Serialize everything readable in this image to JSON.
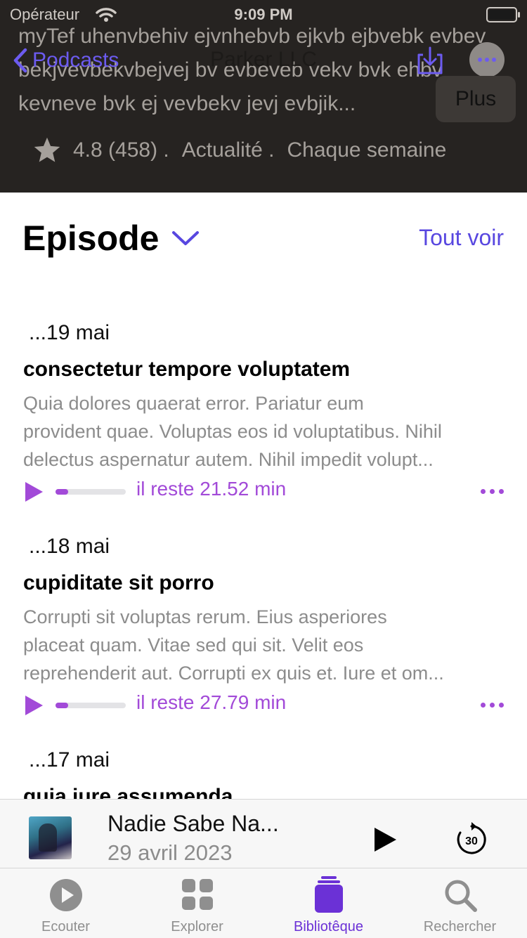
{
  "status_bar": {
    "carrier": "Opérateur",
    "time": "9:09 PM"
  },
  "podcast": {
    "description": "myTef uhenvbehiv ejvnhebvb ejkvb ejbvebk evbev bekjvevbekvbejvej bv evbeveb vekv bvk ehbv kevneve bvk ej vevbekv jevj evbjik...",
    "rating_text": "4.8 (458) .",
    "category": "Actualité .",
    "frequency": "Chaque semaine"
  },
  "nav": {
    "back_label": "Podcasts",
    "title": "Parker LLC",
    "more_popup": "Plus"
  },
  "episodes_header": {
    "title": "Episode",
    "see_all": "Tout voir"
  },
  "episodes": [
    {
      "date": "...19 mai",
      "title": "consectetur tempore voluptatem",
      "summary_lines": [
        "Quia dolores quaerat error. Pariatur eum",
        "provident quae. Voluptas eos id voluptatibus. Nihil",
        "delectus aspernatur autem. Nihil impedit volupt..."
      ],
      "remaining": "il reste 21.52 min",
      "progress": 0.18
    },
    {
      "date": "...18 mai",
      "title": "cupiditate sit porro",
      "summary_lines": [
        "Corrupti sit voluptas rerum. Eius asperiores",
        "placeat quam. Vitae sed qui sit. Velit eos",
        "reprehenderit aut. Corrupti ex quis et. Iure et om..."
      ],
      "remaining": "il reste 27.79 min",
      "progress": 0.18
    },
    {
      "date": "...17 mai",
      "title": "quia iure assumenda"
    }
  ],
  "now_playing": {
    "title": "Nadie Sabe Na...",
    "date": "29 avril 2023",
    "skip_seconds": "30"
  },
  "tabs": [
    {
      "label": "Ecouter",
      "icon": "play-circle-icon"
    },
    {
      "label": "Explorer",
      "icon": "grid-icon"
    },
    {
      "label": "Bibliotêque",
      "icon": "library-stack-icon"
    },
    {
      "label": "Rechercher",
      "icon": "magnifier-icon"
    }
  ],
  "colors": {
    "accent": "#6c5bf0",
    "episode_accent": "#a24ad8",
    "tab_active": "#6b31d6",
    "header_bg": "#262321"
  }
}
